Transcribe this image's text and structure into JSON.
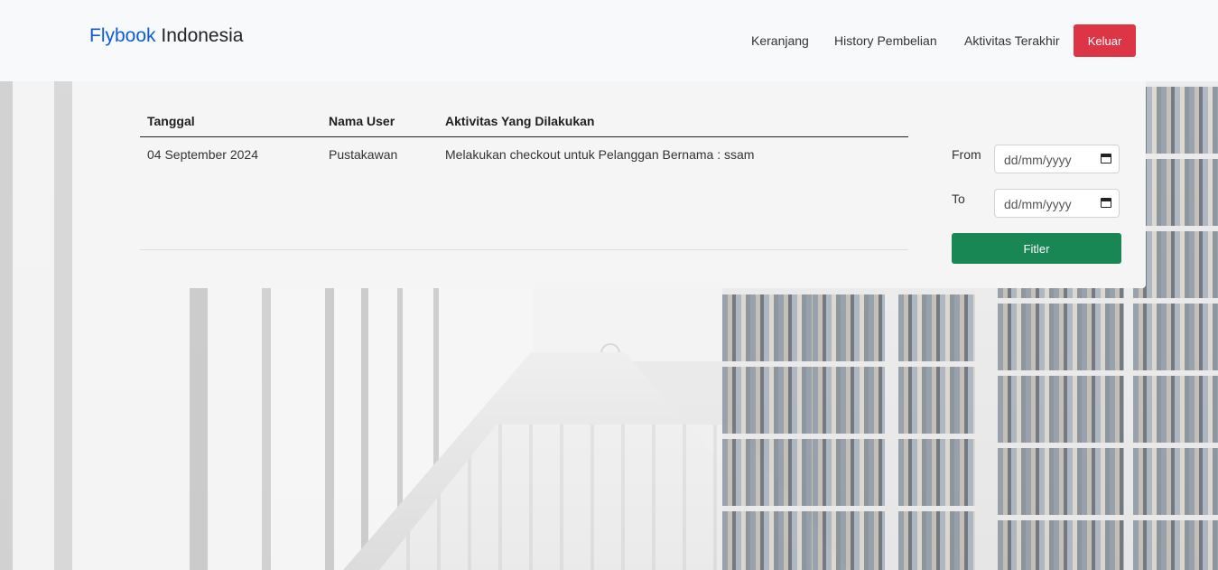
{
  "brand": {
    "part1": "Flybook",
    "part2": "Indonesia"
  },
  "nav": {
    "cart": "Keranjang",
    "history": "History Pembelian",
    "activity": "Aktivitas Terakhir",
    "logout": "Keluar"
  },
  "table": {
    "headers": [
      "Tanggal",
      "Nama User",
      "Aktivitas Yang Dilakukan"
    ],
    "rows": [
      [
        "04 September 2024",
        "Pustakawan",
        "Melakukan checkout untuk Pelanggan Bernama : ssam"
      ]
    ]
  },
  "filter": {
    "from_label": "From",
    "to_label": "To",
    "from_value": "dd/mm/yyyy",
    "to_value": "dd/mm/yyyy",
    "button": "Fitler"
  },
  "colors": {
    "brand_blue": "#0d5bd8",
    "logout": "#dc3545",
    "filter": "#198754"
  },
  "icons": [
    "calendar-icon"
  ]
}
